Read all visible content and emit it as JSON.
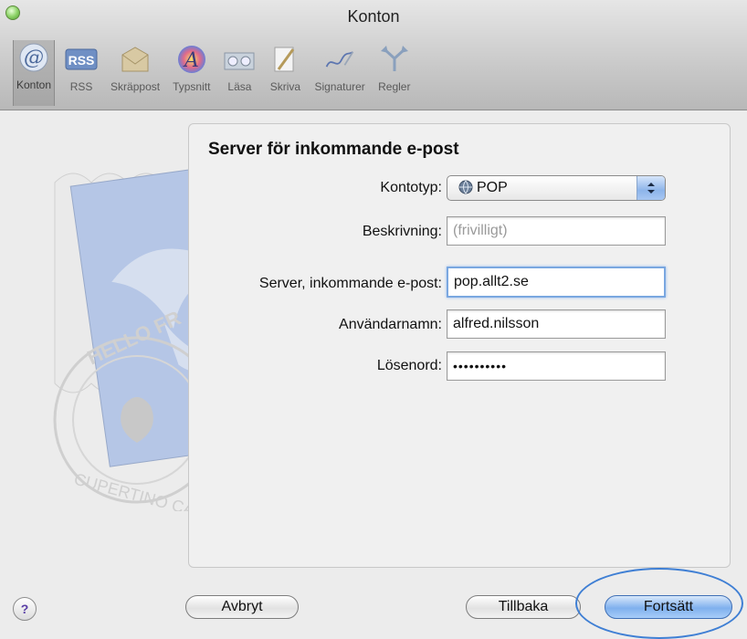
{
  "window": {
    "title": "Konton"
  },
  "toolbar": {
    "items": [
      {
        "label": "Konton",
        "icon": "at-sign-icon",
        "selected": true
      },
      {
        "label": "RSS",
        "icon": "rss-icon",
        "selected": false
      },
      {
        "label": "Skräppost",
        "icon": "junk-mail-icon",
        "selected": false
      },
      {
        "label": "Typsnitt",
        "icon": "fonts-icon",
        "selected": false
      },
      {
        "label": "Läsa",
        "icon": "viewing-icon",
        "selected": false
      },
      {
        "label": "Skriva",
        "icon": "composing-icon",
        "selected": false
      },
      {
        "label": "Signaturer",
        "icon": "signatures-icon",
        "selected": false
      },
      {
        "label": "Regler",
        "icon": "rules-icon",
        "selected": false
      }
    ]
  },
  "form": {
    "title": "Server för inkommande e-post",
    "account_type": {
      "label": "Kontotyp:",
      "value": "POP"
    },
    "description": {
      "label": "Beskrivning:",
      "placeholder": "(frivilligt)"
    },
    "incoming_server": {
      "label": "Server, inkommande e-post:",
      "value": "pop.allt2.se"
    },
    "username": {
      "label": "Användarnamn:",
      "value": "alfred.nilsson"
    },
    "password": {
      "label": "Lösenord:",
      "value": "••••••••••"
    }
  },
  "buttons": {
    "help": "?",
    "cancel": "Avbryt",
    "back": "Tillbaka",
    "continue": "Fortsätt"
  },
  "stamp": {
    "text_top": "HELLO FR",
    "text_bottom": "CUPERTINO CA"
  },
  "colors": {
    "accent": "#7fb0ee",
    "highlight": "#3f7fd4"
  }
}
